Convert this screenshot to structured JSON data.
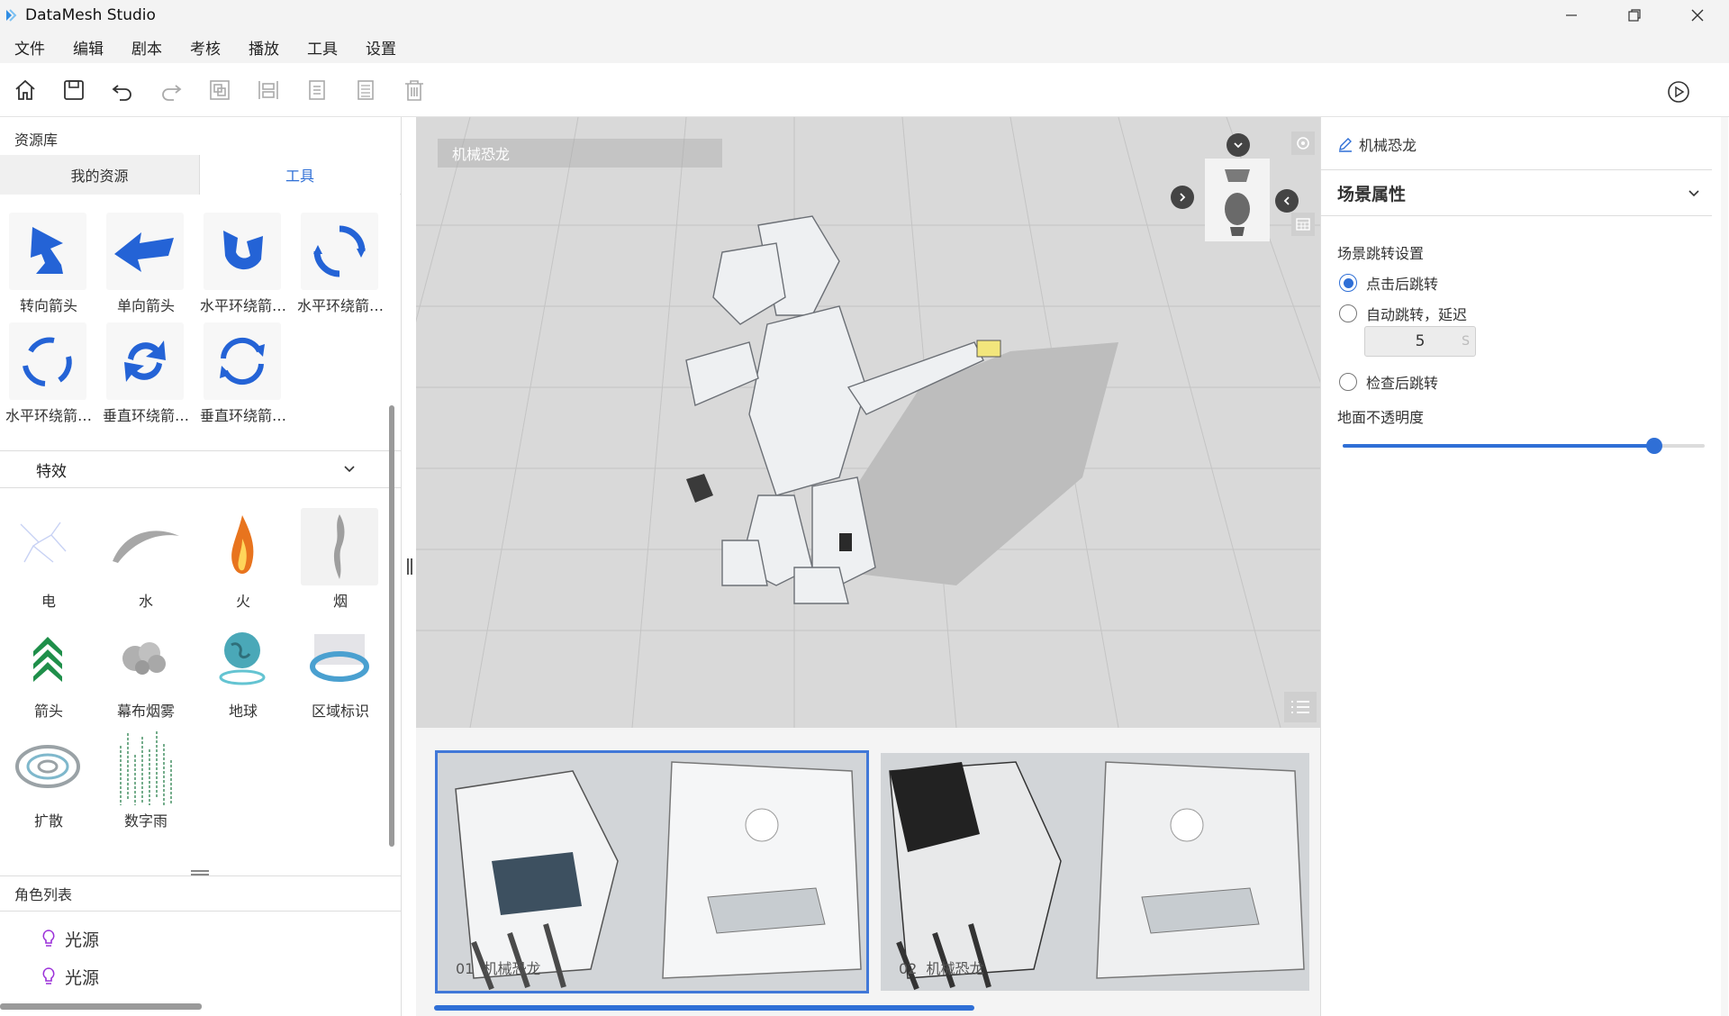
{
  "app": {
    "title": "DataMesh Studio"
  },
  "menu": [
    "文件",
    "编辑",
    "剧本",
    "考核",
    "播放",
    "工具",
    "设置"
  ],
  "toolbar": {
    "icons": [
      "home-icon",
      "save-icon",
      "undo-icon",
      "redo-icon",
      "group-icon",
      "align-icon",
      "copy-icon",
      "list-icon",
      "delete-icon",
      "play-icon"
    ]
  },
  "library": {
    "header": "资源库",
    "tabs": {
      "mine": "我的资源",
      "tools": "工具"
    },
    "tools": [
      {
        "label": "转向箭头"
      },
      {
        "label": "单向箭头"
      },
      {
        "label": "水平环绕箭…"
      },
      {
        "label": "水平环绕箭…"
      },
      {
        "label": "水平环绕箭…"
      },
      {
        "label": "垂直环绕箭…"
      },
      {
        "label": "垂直环绕箭…"
      }
    ],
    "effects_section": "特效",
    "effects": [
      {
        "label": "电"
      },
      {
        "label": "水"
      },
      {
        "label": "火"
      },
      {
        "label": "烟"
      },
      {
        "label": "箭头"
      },
      {
        "label": "幕布烟雾"
      },
      {
        "label": "地球"
      },
      {
        "label": "区域标识"
      },
      {
        "label": "扩散"
      },
      {
        "label": "数字雨"
      }
    ]
  },
  "roles": {
    "header": "角色列表",
    "items": [
      "光源",
      "光源"
    ]
  },
  "viewport": {
    "label": "机械恐龙"
  },
  "scenes": [
    {
      "index": "01",
      "name": "机械恐龙",
      "selected": true
    },
    {
      "index": "02",
      "name": "机械恐龙",
      "selected": false
    }
  ],
  "properties": {
    "object_name": "机械恐龙",
    "section": "场景属性",
    "jump_label": "场景跳转设置",
    "options": [
      "点击后跳转",
      "自动跳转，延迟",
      "检查后跳转"
    ],
    "selected_option": 0,
    "delay_value": "5",
    "delay_unit": "S",
    "opacity_label": "地面不透明度",
    "opacity": 0.86
  },
  "colors": {
    "accent": "#2f6fd6",
    "arrow_blue": "#2463d6"
  }
}
